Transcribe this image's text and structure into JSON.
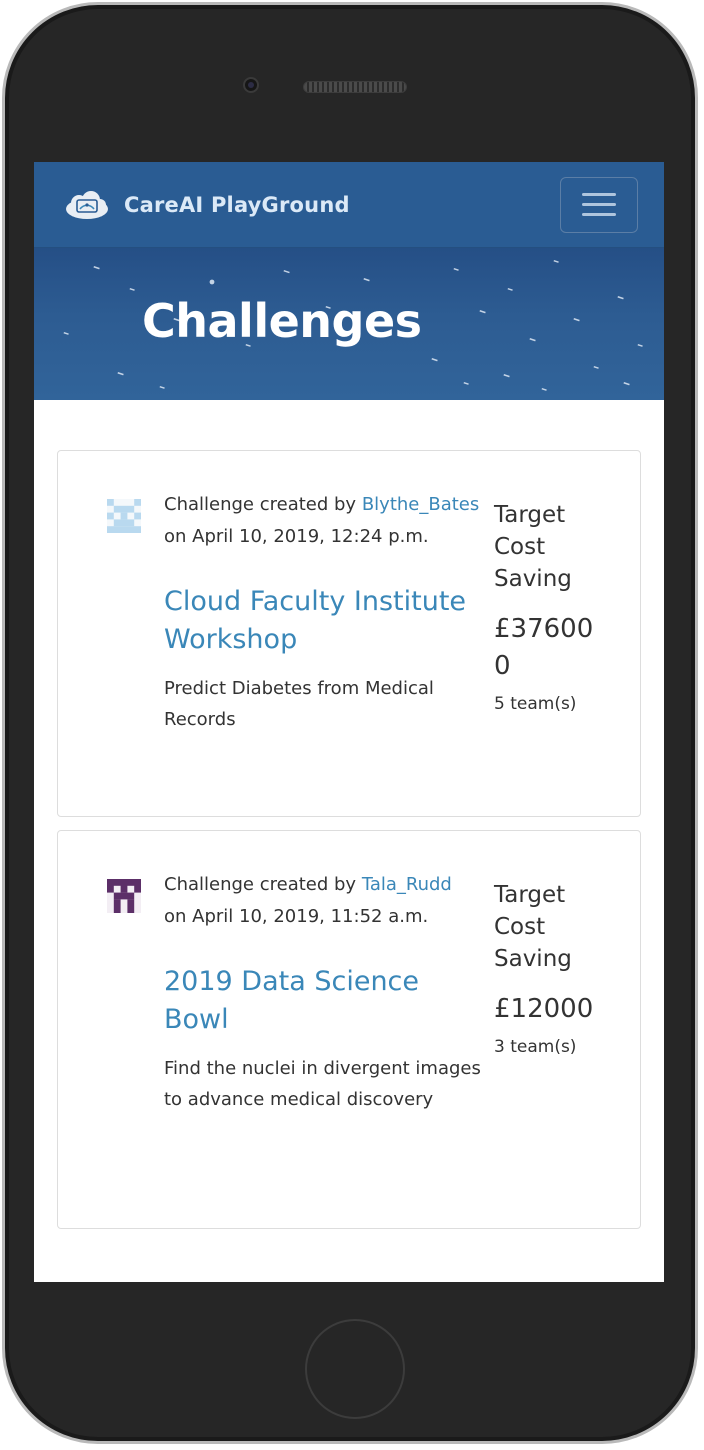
{
  "app": {
    "brand_name": "CareAI PlayGround",
    "logo_icon": "cloud-logo-icon",
    "menu_icon": "hamburger-menu-icon"
  },
  "hero": {
    "title": "Challenges"
  },
  "challenges": [
    {
      "created_prefix": "Challenge created by",
      "author": "Blythe_Bates",
      "created_on": "on April 10, 2019, 12:24 p.m.",
      "title": "Cloud Faculty Institute Workshop",
      "description": "Predict Diabetes from Medical Records",
      "target_label": "Target Cost Saving",
      "amount": "£376000",
      "teams": "5 team(s)",
      "avatar_color": "#b9d9ef"
    },
    {
      "created_prefix": "Challenge created by",
      "author": "Tala_Rudd",
      "created_on": "on April 10, 2019, 11:52 a.m.",
      "title": "2019 Data Science Bowl",
      "description": "Find the nuclei in divergent images to advance medical discovery",
      "target_label": "Target Cost Saving",
      "amount": "£12000",
      "teams": "3 team(s)",
      "avatar_color": "#5c2f68"
    }
  ],
  "colors": {
    "navbar": "#2a5c93",
    "link": "#3a87b8",
    "text": "#333333"
  }
}
